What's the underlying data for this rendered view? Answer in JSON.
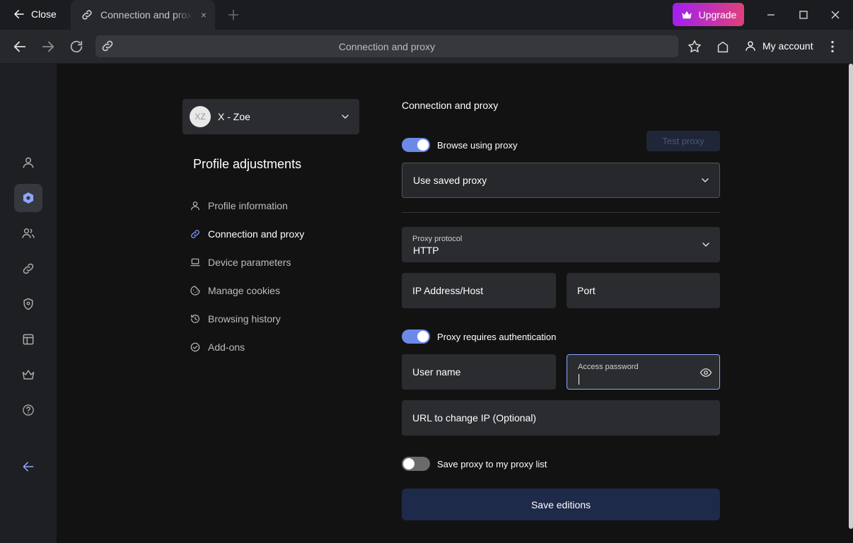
{
  "titlebar": {
    "close_label": "Close",
    "tab_label": "Connection and proxy",
    "tab_close": "×",
    "upgrade_label": "Upgrade"
  },
  "navbar": {
    "url_text": "Connection and proxy",
    "account_label": "My account"
  },
  "sidebar": {
    "icons": [
      "user-icon",
      "hexagon-icon",
      "users-icon",
      "link-icon",
      "shield-icon",
      "layout-icon",
      "crown-icon",
      "help-icon",
      "arrow-left-icon"
    ],
    "active_index": 1,
    "accent": "#8fa6ff"
  },
  "profile": {
    "avatar_initials": "XZ",
    "name": "X - Zoe",
    "title": "Profile adjustments",
    "menu": [
      {
        "label": "Profile information",
        "icon": "user-icon"
      },
      {
        "label": "Connection and proxy",
        "icon": "link-icon",
        "active": true
      },
      {
        "label": "Device parameters",
        "icon": "laptop-icon"
      },
      {
        "label": "Manage cookies",
        "icon": "cookie-icon"
      },
      {
        "label": "Browsing history",
        "icon": "history-icon"
      },
      {
        "label": "Add-ons",
        "icon": "check-circle-icon"
      }
    ]
  },
  "form": {
    "title": "Connection and proxy",
    "browse_proxy_label": "Browse using proxy",
    "browse_proxy_on": true,
    "test_proxy_label": "Test proxy",
    "saved_proxy_label": "Use saved proxy",
    "protocol_label": "Proxy protocol",
    "protocol_value": "HTTP",
    "ip_label": "IP Address/Host",
    "port_label": "Port",
    "auth_label": "Proxy requires authentication",
    "auth_on": true,
    "username_label": "User name",
    "password_label": "Access password",
    "change_ip_label": "URL to change IP (Optional)",
    "save_proxy_label": "Save proxy to my proxy list",
    "save_proxy_on": false,
    "save_button": "Save editions"
  },
  "colors": {
    "toggle_on": "#6b8ae8",
    "upgrade_gradient_start": "#a020f0",
    "upgrade_gradient_end": "#e0407a",
    "save_button_bg": "#1e2a4a"
  }
}
